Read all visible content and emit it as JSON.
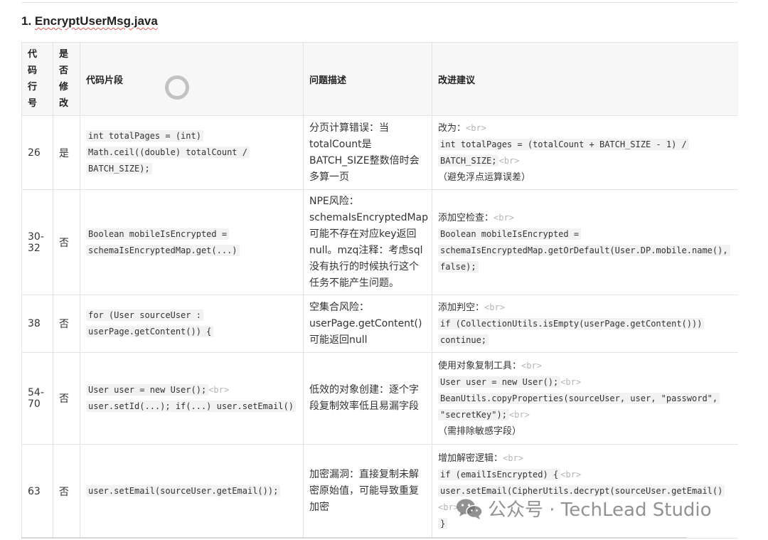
{
  "heading": {
    "number": "1.",
    "filename": "EncryptUserMsg.java"
  },
  "table": {
    "headers": {
      "line": "代码行号",
      "modified": "是否修改",
      "snippet": "代码片段",
      "problem": "问题描述",
      "suggestion": "改进建议"
    },
    "rows": [
      {
        "line": "26",
        "modified": "是",
        "snippet": "int totalPages = (int) Math.ceil((double) totalCount / BATCH_SIZE);",
        "problem": "分页计算错误：当totalCount是BATCH_SIZE整数倍时会多算一页",
        "suggestion": [
          {
            "t": "改为："
          },
          {
            "br": "<br>"
          },
          {
            "n": true
          },
          {
            "c": "int totalPages = (totalCount + BATCH_SIZE - 1) /"
          },
          {
            "n": true
          },
          {
            "c": "BATCH_SIZE;"
          },
          {
            "br": "<br>"
          },
          {
            "n": true
          },
          {
            "t": "（避免浮点运算误差）"
          }
        ]
      },
      {
        "line": "30-32",
        "modified": "否",
        "snippet": "Boolean mobileIsEncrypted = schemaIsEncryptedMap.get(...)",
        "problem": "NPE风险：schemaIsEncryptedMap可能不存在对应key返回null。mzq注释：考虑sql没有执行的时候执行这个任务不能产生问题。",
        "suggestion": [
          {
            "t": "添加空检查："
          },
          {
            "br": "<br>"
          },
          {
            "n": true
          },
          {
            "c": "Boolean mobileIsEncrypted ="
          },
          {
            "n": true
          },
          {
            "c": "schemaIsEncryptedMap.getOrDefault(User.DP.mobile.name(),"
          },
          {
            "n": true
          },
          {
            "c": "false);"
          }
        ]
      },
      {
        "line": "38",
        "modified": "否",
        "snippet": "for (User sourceUser : userPage.getContent()) {",
        "problem": "空集合风险：userPage.getContent()可能返回null",
        "suggestion": [
          {
            "t": "添加判空："
          },
          {
            "br": "<br>"
          },
          {
            "n": true
          },
          {
            "c": "if (CollectionUtils.isEmpty(userPage.getContent()))"
          },
          {
            "n": true
          },
          {
            "c": "continue;"
          }
        ]
      },
      {
        "line": "54-70",
        "modified": "否",
        "snippet": "User user = new User();",
        "snippet_br": "<br>",
        "snippet_rest": "user.setId(...); if(...) user.setEmail()",
        "problem": "低效的对象创建：逐个字段复制效率低且易漏字段",
        "suggestion": [
          {
            "t": "使用对象复制工具："
          },
          {
            "br": "<br>"
          },
          {
            "n": true
          },
          {
            "c": "User user = new User();"
          },
          {
            "br": "<br>"
          },
          {
            "n": true
          },
          {
            "c": "BeanUtils.copyProperties(sourceUser, user, \"password\","
          },
          {
            "n": true
          },
          {
            "c": "\"secretKey\");"
          },
          {
            "br": "<br>"
          },
          {
            "n": true
          },
          {
            "t": "（需排除敏感字段）"
          }
        ]
      },
      {
        "line": "63",
        "modified": "否",
        "snippet": "user.setEmail(sourceUser.getEmail());",
        "problem": "加密漏洞：直接复制未解密原始值，可能导致重复加密",
        "suggestion": [
          {
            "t": "增加解密逻辑："
          },
          {
            "br": "<br>"
          },
          {
            "n": true
          },
          {
            "c": "if (emailIsEncrypted) {"
          },
          {
            "br": "<br>"
          },
          {
            "n": true
          },
          {
            "c": "user.setEmail(CipherUtils.decrypt(sourceUser.getEmail()"
          },
          {
            "n": true
          },
          {
            "br": "<br>"
          },
          {
            "n": true
          },
          {
            "c": "}"
          }
        ]
      }
    ]
  },
  "watermark": {
    "text": "公众号 · TechLead Studio",
    "icon": "wechat-icon"
  }
}
